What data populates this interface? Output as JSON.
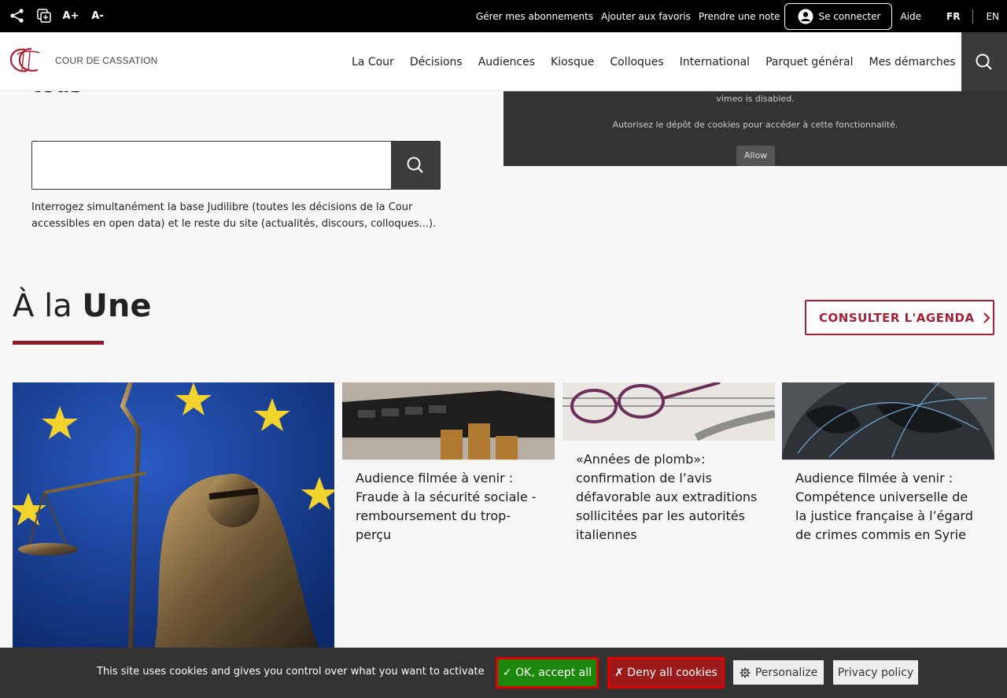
{
  "topbar": {
    "tools": {
      "share_icon": "share-icon",
      "copy_icon": "copy-icon",
      "font_increase": "A+",
      "font_decrease": "A-"
    },
    "links": [
      "Gérer mes abonnements",
      "Ajouter aux favoris",
      "Prendre une note"
    ],
    "login_label": "Se connecter",
    "help_label": "Aide",
    "lang_fr": "FR",
    "lang_en": "EN"
  },
  "header": {
    "logo_text": "COUR DE CASSATION",
    "nav": [
      "La Cour",
      "Décisions",
      "Audiences",
      "Kiosque",
      "Colloques",
      "International",
      "Parquet général",
      "Mes démarches"
    ],
    "brand_color": "#a71f32"
  },
  "hero": {
    "title_fragment": "tous",
    "search_value": "",
    "search_help": "Interrogez simultanément la base Judilibre (toutes les décisions de la Cour accessibles en open data) et le reste du site (actualités, discours, colloques...)."
  },
  "video": {
    "disabled_text": "vimeo is disabled.",
    "consent_text": "Autorisez le dépôt de cookies pour accéder à cette fonctionnalité.",
    "allow_label": "Allow"
  },
  "une": {
    "title_light": "À la",
    "title_bold": "Une",
    "agenda_label": "CONSULTER L'AGENDA",
    "cards": [
      "Audience filmée à venir : Fraude à la sécurité sociale - remboursement du trop-perçu",
      "«Années de plomb»: confirmation de l’avis défavorable aux extraditions sollicitées par les autorités italiennes",
      "Audience filmée à venir : Compétence universelle de la justice française à l’égard de crimes commis en Syrie"
    ]
  },
  "cookie": {
    "message": "This site uses cookies and gives you control over what you want to activate",
    "accept_label": "✓ OK, accept all",
    "deny_label": "✗ Deny all cookies",
    "personalize_label": "Personalize",
    "privacy_label": "Privacy policy"
  }
}
